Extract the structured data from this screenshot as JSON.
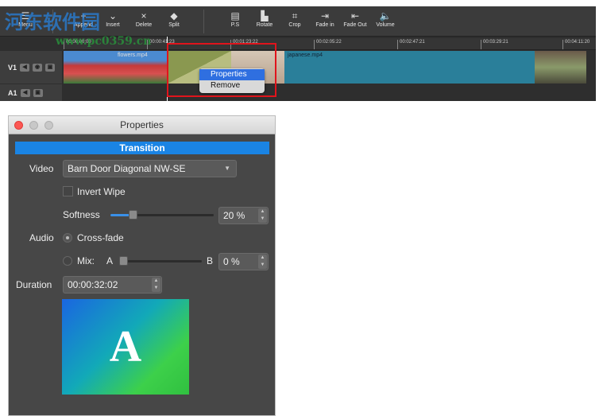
{
  "watermark": {
    "text": "河东软件园",
    "url_text": "www.pc0359.cn"
  },
  "toolbar": {
    "items": [
      {
        "label": "Menu",
        "icon": "menu-icon"
      },
      {
        "label": "Append",
        "icon": "plus-icon"
      },
      {
        "label": "Insert",
        "icon": "insert-icon"
      },
      {
        "label": "Delete",
        "icon": "delete-icon"
      },
      {
        "label": "Split",
        "icon": "split-icon"
      },
      {
        "label": "P.S",
        "icon": "ps-icon"
      },
      {
        "label": "Rotate",
        "icon": "rotate-icon"
      },
      {
        "label": "Crop",
        "icon": "crop-icon"
      },
      {
        "label": "Fade in",
        "icon": "fade-in-icon"
      },
      {
        "label": "Fade Out",
        "icon": "fade-out-icon"
      },
      {
        "label": "Volume",
        "icon": "volume-icon"
      }
    ]
  },
  "ruler": {
    "ticks": [
      "00:00:00:00",
      "00:00:41:23",
      "00:01:23:22",
      "00:02:05:22",
      "00:02:47:21",
      "00:03:29:21",
      "00:04:11:20"
    ]
  },
  "tracks": {
    "v1": "V1",
    "a1": "A1"
  },
  "clips": {
    "flowers": "flowers.mp4",
    "japanese": "japanese.mp4"
  },
  "context_menu": {
    "items": [
      "Properties",
      "Remove"
    ]
  },
  "properties": {
    "title": "Properties",
    "section": "Transition",
    "video_label": "Video",
    "video_value": "Barn Door Diagonal NW-SE",
    "invert_wipe": "Invert Wipe",
    "invert_wipe_checked": false,
    "softness_label": "Softness",
    "softness_value": "20 %",
    "softness_percent": 20,
    "audio_label": "Audio",
    "crossfade": "Cross-fade",
    "crossfade_selected": true,
    "mix_label": "Mix:",
    "mix_a": "A",
    "mix_b": "B",
    "mix_value": "0 %",
    "mix_percent": 0,
    "duration_label": "Duration",
    "duration_value": "00:00:32:02",
    "preview_letter": "A"
  },
  "colors": {
    "accent": "#1a84e4",
    "highlight": "#e0141c",
    "clip": "#2a7f9a"
  }
}
